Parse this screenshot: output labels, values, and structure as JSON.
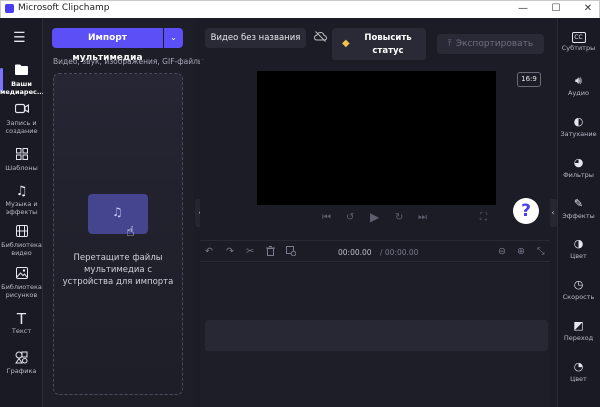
{
  "window": {
    "title": "Microsoft Clipchamp",
    "minimize": "—",
    "maximize": "☐",
    "close": "✕"
  },
  "left_nav": {
    "menu_icon": "☰",
    "items": [
      {
        "label": "Ваши медиарес...",
        "icon": "folder-icon"
      },
      {
        "label": "Запись и создание",
        "icon": "camera-icon"
      },
      {
        "label": "Шаблоны",
        "icon": "templates-icon"
      },
      {
        "label": "Музыка и эффекты",
        "icon": "music-icon"
      },
      {
        "label": "Библиотека видео",
        "icon": "film-icon"
      },
      {
        "label": "Библиотека рисунков",
        "icon": "image-icon"
      },
      {
        "label": "Текст",
        "icon": "text-icon"
      },
      {
        "label": "Графика",
        "icon": "graphics-icon"
      }
    ]
  },
  "media": {
    "import_label": "Импорт мультимедиа",
    "import_hint": "Видео, звук, изображения, GIF-файлы",
    "drop_text": "Перетащите файлы мультимедиа с устройства для импорта"
  },
  "toolbar": {
    "project_title": "Видео без названия",
    "upgrade_label": "Повысить статус",
    "export_label": "Экспортировать"
  },
  "preview": {
    "aspect_ratio": "16:9",
    "help": "?"
  },
  "timeline": {
    "current_time": "00:00.00",
    "total_time": "/ 00:00.00"
  },
  "right_panel": {
    "items": [
      {
        "label": "Субтитры",
        "icon": "captions-icon"
      },
      {
        "label": "Аудио",
        "icon": "speaker-icon"
      },
      {
        "label": "Затухание",
        "icon": "fade-icon"
      },
      {
        "label": "Фильтры",
        "icon": "filters-icon"
      },
      {
        "label": "Эффекты",
        "icon": "effects-icon"
      },
      {
        "label": "Цвет",
        "icon": "color-icon"
      },
      {
        "label": "Скорость",
        "icon": "speed-icon"
      },
      {
        "label": "Переход",
        "icon": "transition-icon"
      },
      {
        "label": "Цвет",
        "icon": "palette-icon"
      }
    ]
  },
  "colors": {
    "accent": "#5b4ff5",
    "background": "#1c1c26"
  }
}
